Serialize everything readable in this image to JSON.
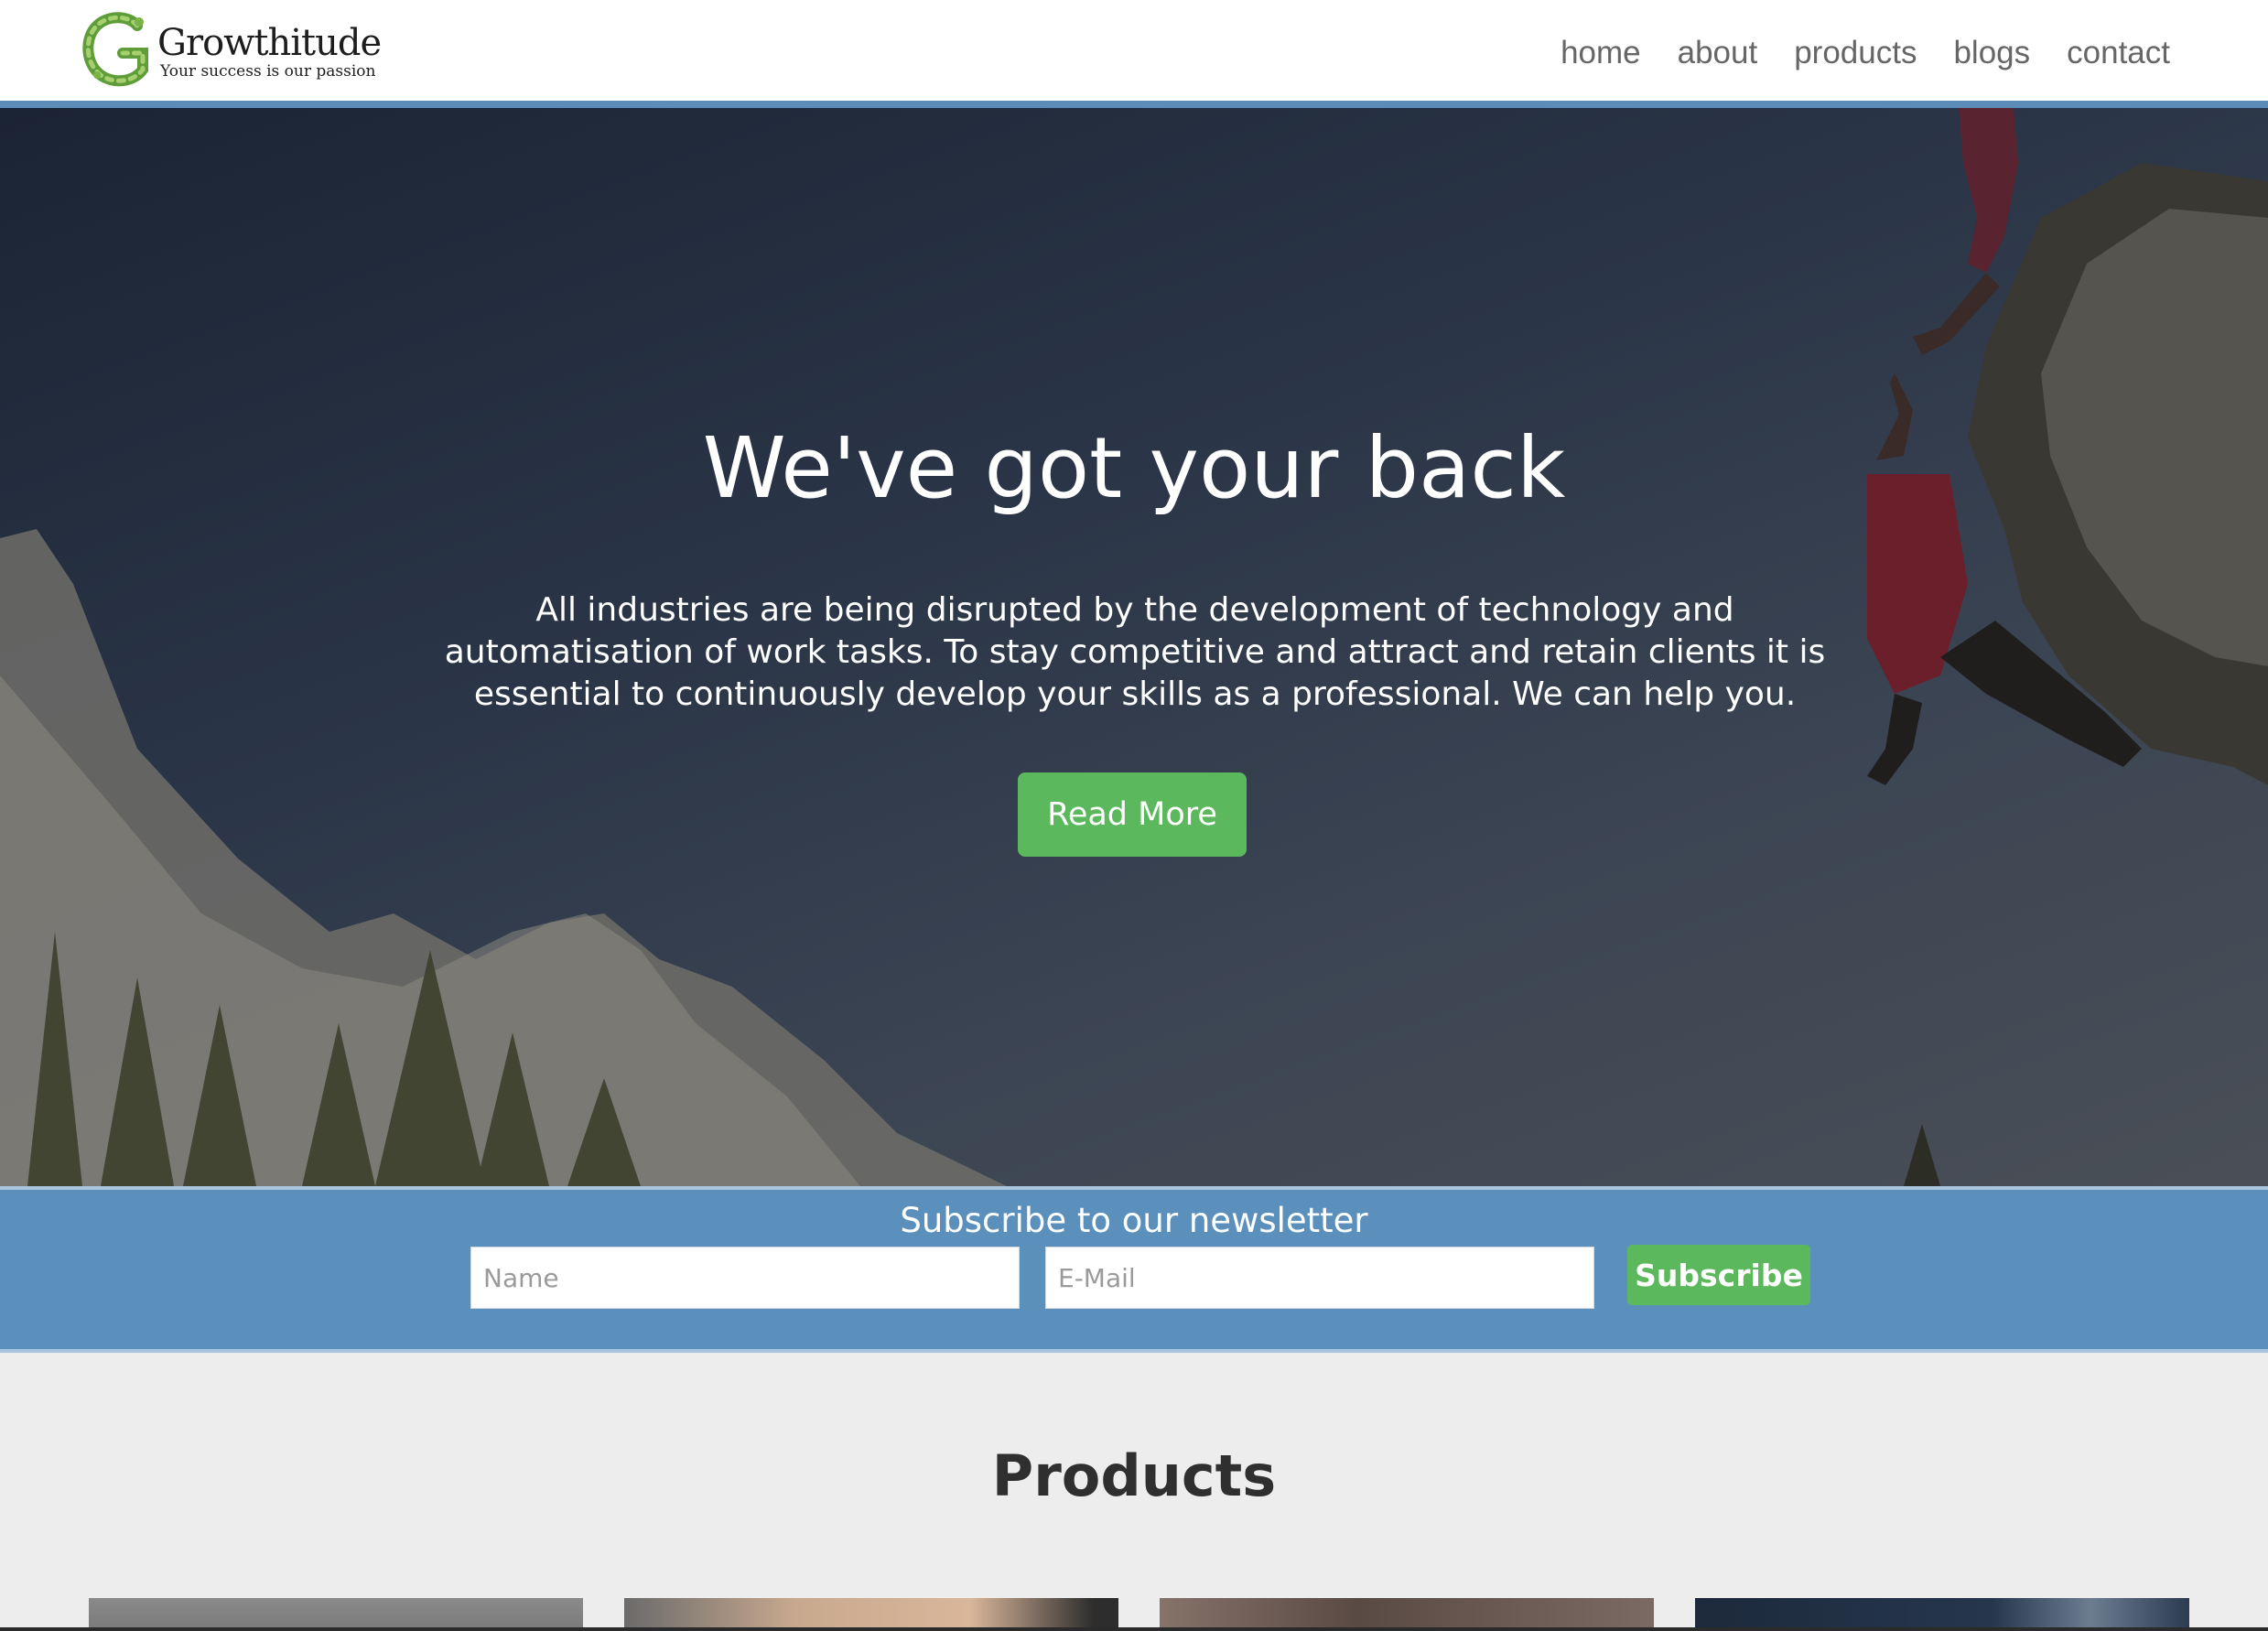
{
  "header": {
    "logo_name": "Growthitude",
    "logo_tagline": "Your success is our passion",
    "nav": [
      "home",
      "about",
      "products",
      "blogs",
      "contact"
    ]
  },
  "hero": {
    "title": "We've got your back",
    "body": "All industries are being disrupted by the development of technology and automatisation of work tasks. To stay competitive and attract and retain clients it is essential to continuously develop your skills as a professional. We can help you.",
    "button_label": "Read More"
  },
  "newsletter": {
    "title": "Subscribe to our newsletter",
    "name_placeholder": "Name",
    "email_placeholder": "E-Mail",
    "button_label": "Subscribe"
  },
  "products": {
    "title": "Products"
  },
  "colors": {
    "accent_blue": "#5b8db8",
    "accent_green": "#5cb85c",
    "page_bg": "#ededed"
  }
}
